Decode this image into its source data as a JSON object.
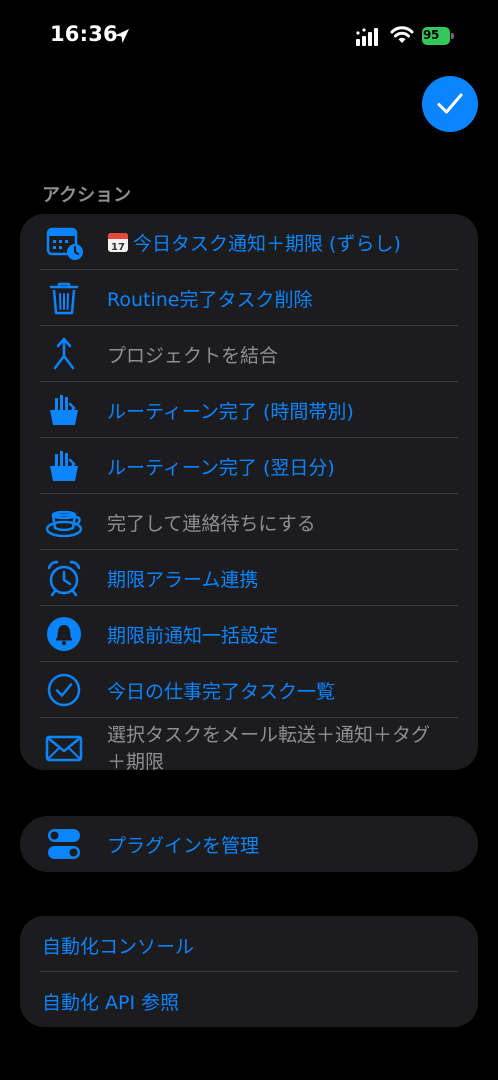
{
  "status_bar": {
    "time": "16:36",
    "battery": "95"
  },
  "section_header": "アクション",
  "actions": [
    {
      "label": "今日タスク通知＋期限 (ずらし)",
      "icon": "calendar-clock-icon",
      "enabled": true
    },
    {
      "label": "Routine完了タスク削除",
      "icon": "trash-icon",
      "enabled": true
    },
    {
      "label": "プロジェクトを結合",
      "icon": "merge-arrow-icon",
      "enabled": false
    },
    {
      "label": "ルーティーン完了 (時間帯別)",
      "icon": "hand-check-icon",
      "enabled": true
    },
    {
      "label": "ルーティーン完了 (翌日分)",
      "icon": "hand-check-icon",
      "enabled": true
    },
    {
      "label": "完了して連絡待ちにする",
      "icon": "cup-icon",
      "enabled": false
    },
    {
      "label": "期限アラーム連携",
      "icon": "alarm-clock-icon",
      "enabled": true
    },
    {
      "label": "期限前通知一括設定",
      "icon": "bell-icon",
      "enabled": true
    },
    {
      "label": "今日の仕事完了タスク一覧",
      "icon": "checkmark-circle-icon",
      "enabled": true
    },
    {
      "label_line1": "選択タスクをメール転送＋通知＋タグ",
      "label_line2": "＋期限",
      "icon": "envelope-icon",
      "enabled": false
    }
  ],
  "plugins": {
    "label": "プラグインを管理",
    "icon": "toggles-icon"
  },
  "automation": {
    "console_label": "自動化コンソール",
    "api_label": "自動化 API 参照"
  },
  "colors": {
    "accent": "#0a84ff",
    "disabled_text": "#8e8e93",
    "card_bg": "#1c1c1e",
    "background": "#000000",
    "battery": "#34c759"
  }
}
